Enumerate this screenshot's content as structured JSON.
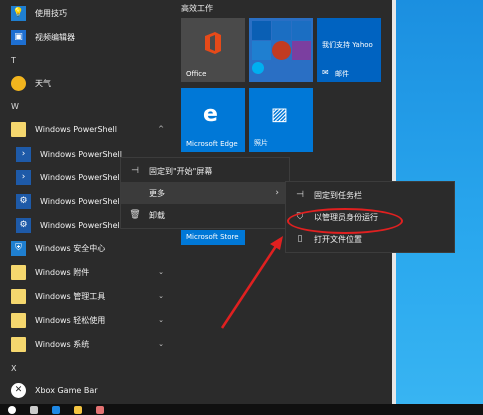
{
  "applist": {
    "items": [
      {
        "label": "使用技巧",
        "icon": "tips-icon"
      },
      {
        "label": "视频编辑器",
        "icon": "video-editor-icon"
      },
      {
        "letter": "T"
      },
      {
        "label": "天气",
        "icon": "weather-icon"
      },
      {
        "letter": "W"
      },
      {
        "label": "Windows PowerShell",
        "icon": "folder-icon",
        "chevron": "^"
      },
      {
        "label": "Windows PowerShell",
        "icon": "powershell-icon"
      },
      {
        "label": "Windows PowerShell",
        "icon": "powershell-icon"
      },
      {
        "label": "Windows PowerShell",
        "icon": "powershell-ise-icon"
      },
      {
        "label": "Windows PowerShell",
        "icon": "powershell-ise-icon"
      },
      {
        "label": "Windows 安全中心",
        "icon": "security-shield-icon"
      },
      {
        "label": "Windows 附件",
        "icon": "folder-icon",
        "chevron": "v"
      },
      {
        "label": "Windows 管理工具",
        "icon": "folder-icon",
        "chevron": "v"
      },
      {
        "label": "Windows 轻松使用",
        "icon": "folder-icon",
        "chevron": "v"
      },
      {
        "label": "Windows 系统",
        "icon": "folder-icon",
        "chevron": "v"
      },
      {
        "letter": "X"
      },
      {
        "label": "Xbox Game Bar",
        "icon": "xbox-icon"
      }
    ]
  },
  "tiles": {
    "section_title": "高效工作",
    "office": "Office",
    "yahoo": "我们支持 Yahoo",
    "mail": "邮件",
    "edge": "Microsoft Edge",
    "photos": "照片",
    "store": "Microsoft Store"
  },
  "context_menu_1": {
    "pin_start": "固定到\"开始\"屏幕",
    "more": "更多",
    "uninstall": "卸载"
  },
  "context_menu_2": {
    "pin_taskbar": "固定到任务栏",
    "run_as_admin": "以管理员身份运行",
    "open_location": "打开文件位置"
  },
  "colors": {
    "accent": "#0078d7",
    "annotation": "#e02020"
  }
}
